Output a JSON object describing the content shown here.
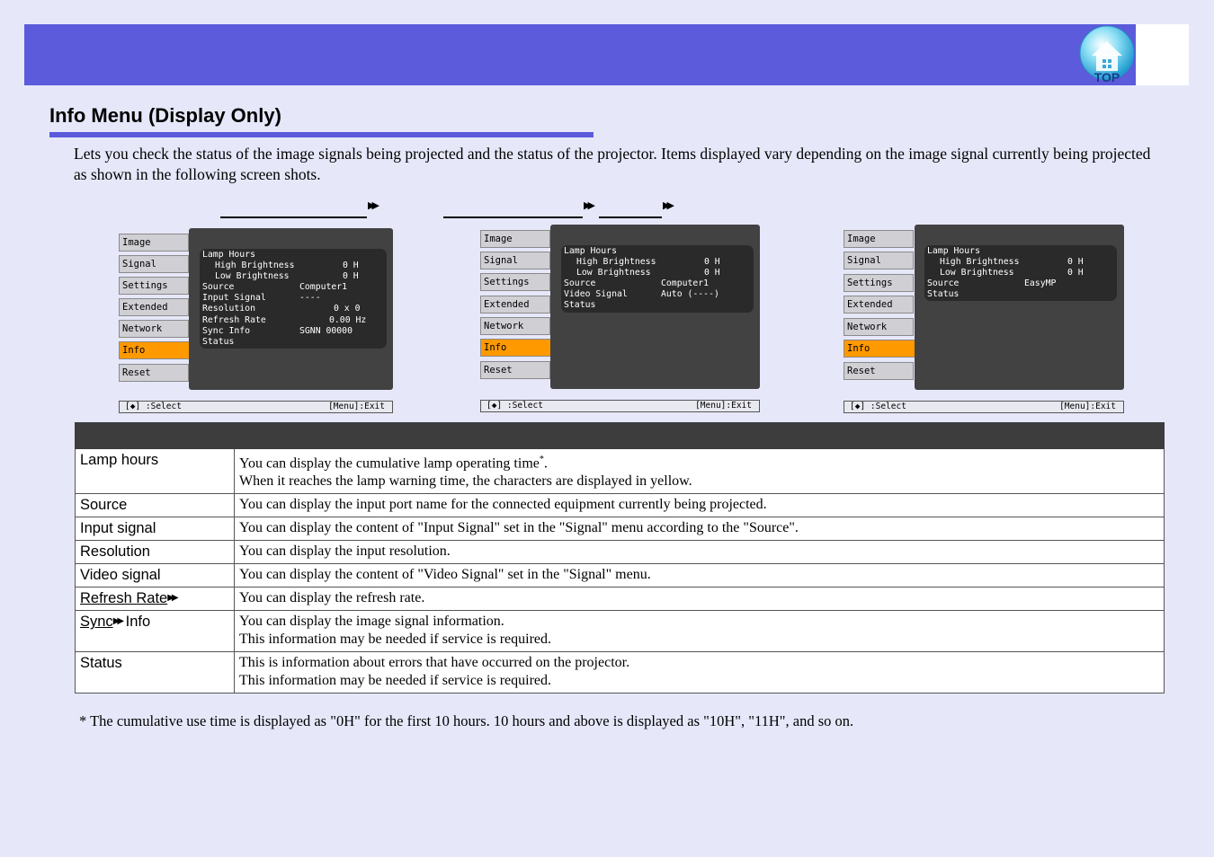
{
  "header": {
    "top_label": "TOP"
  },
  "section": {
    "title": "Info Menu (Display Only)",
    "intro": "Lets you check the status of the image signals being projected and the status of the projector. Items displayed vary depending on the image signal currently being projected as shown in the following screen shots."
  },
  "screens": [
    {
      "tabs": [
        "Image",
        "Signal",
        "Settings",
        "Extended",
        "Network",
        "Info",
        "Reset"
      ],
      "active": "Info",
      "rows": [
        {
          "key": "Lamp Hours",
          "value": "",
          "indent": false
        },
        {
          "key": "High Brightness",
          "value": "0  H",
          "indent": true
        },
        {
          "key": "Low Brightness",
          "value": "0  H",
          "indent": true
        },
        {
          "key": "Source",
          "value": "Computer1",
          "indent": false
        },
        {
          "key": "Input Signal",
          "value": "----",
          "indent": false
        },
        {
          "key": "Resolution",
          "value": "0  x      0",
          "indent": false
        },
        {
          "key": "Refresh Rate",
          "value": "0.00 Hz",
          "indent": false
        },
        {
          "key": "Sync Info",
          "value": "SGNN 00000",
          "indent": false
        },
        {
          "key": "Status",
          "value": "",
          "indent": false
        }
      ],
      "footer_left": "[◆] :Select",
      "footer_right": "[Menu]:Exit"
    },
    {
      "tabs": [
        "Image",
        "Signal",
        "Settings",
        "Extended",
        "Network",
        "Info",
        "Reset"
      ],
      "active": "Info",
      "rows": [
        {
          "key": "Lamp Hours",
          "value": "",
          "indent": false
        },
        {
          "key": "High Brightness",
          "value": "0  H",
          "indent": true
        },
        {
          "key": "Low Brightness",
          "value": "0  H",
          "indent": true
        },
        {
          "key": "Source",
          "value": "Computer1",
          "indent": false
        },
        {
          "key": "Video Signal",
          "value": "Auto (----)",
          "indent": false
        },
        {
          "key": "Status",
          "value": "",
          "indent": false
        }
      ],
      "footer_left": "[◆] :Select",
      "footer_right": "[Menu]:Exit"
    },
    {
      "tabs": [
        "Image",
        "Signal",
        "Settings",
        "Extended",
        "Network",
        "Info",
        "Reset"
      ],
      "active": "Info",
      "rows": [
        {
          "key": "Lamp Hours",
          "value": "",
          "indent": false
        },
        {
          "key": "High Brightness",
          "value": "0  H",
          "indent": true
        },
        {
          "key": "Low Brightness",
          "value": "0  H",
          "indent": true
        },
        {
          "key": "Source",
          "value": "EasyMP",
          "indent": false
        },
        {
          "key": "Status",
          "value": "",
          "indent": false
        }
      ],
      "footer_left": "[◆] :Select",
      "footer_right": "[Menu]:Exit"
    }
  ],
  "table": {
    "rows": [
      {
        "item": "Lamp hours",
        "lines": [
          "You can display the cumulative lamp operating time",
          "When it reaches the lamp warning time, the characters are displayed in yellow."
        ],
        "sup": "*"
      },
      {
        "item": "Source",
        "lines": [
          "You can display the input port name for the connected equipment currently being projected."
        ]
      },
      {
        "item": "Input signal",
        "lines": [
          "You can display the content of \"Input Signal\" set in the \"Signal\" menu according to the \"Source\"."
        ]
      },
      {
        "item": "Resolution",
        "lines": [
          "You can display the input resolution."
        ]
      },
      {
        "item": "Video signal",
        "lines": [
          "You can display the content of \"Video Signal\" set in the \"Signal\" menu."
        ]
      },
      {
        "item": "Refresh Rate",
        "lines": [
          "You can display the refresh rate."
        ],
        "link": true
      },
      {
        "item": "Sync",
        "item_suffix": " Info",
        "lines": [
          "You can display the image signal information.",
          "This information may be needed if service is required."
        ],
        "link": true
      },
      {
        "item": "Status",
        "lines": [
          "This is information about errors that have occurred on the projector.",
          "This information may be needed if service is required."
        ]
      }
    ]
  },
  "footnote": "* The cumulative use time is displayed as \"0H\" for the first 10 hours. 10 hours and above is displayed as \"10H\", \"11H\", and so on.",
  "colors": {
    "header": "#5b5bdc",
    "background": "#e6e8fa",
    "active_tab": "#ff9900"
  }
}
